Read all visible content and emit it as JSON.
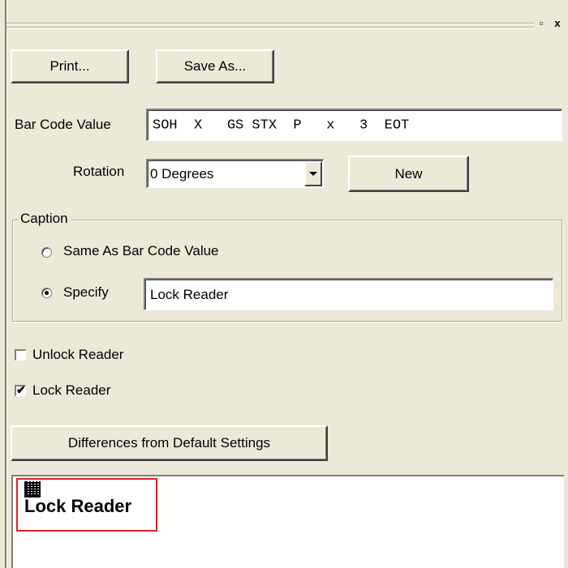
{
  "titlebar": {
    "restore_icon": "restore-icon",
    "close_icon": "close-icon"
  },
  "toolbar": {
    "print_label": "Print...",
    "save_as_label": "Save As..."
  },
  "barcode": {
    "label": "Bar Code Value",
    "value": "SOH  X   GS STX  P   x   3  EOT"
  },
  "rotation": {
    "label": "Rotation",
    "selected": "0 Degrees",
    "new_label": "New"
  },
  "caption": {
    "title": "Caption",
    "same_label": "Same As Bar Code Value",
    "specify_label": "Specify",
    "specify_value": "Lock Reader",
    "selected": "Specify"
  },
  "options": {
    "unlock_label": "Unlock Reader",
    "unlock_checked": false,
    "lock_label": "Lock Reader",
    "lock_checked": true
  },
  "differences_label": "Differences from Default Settings",
  "preview": {
    "caption": "Lock Reader"
  }
}
